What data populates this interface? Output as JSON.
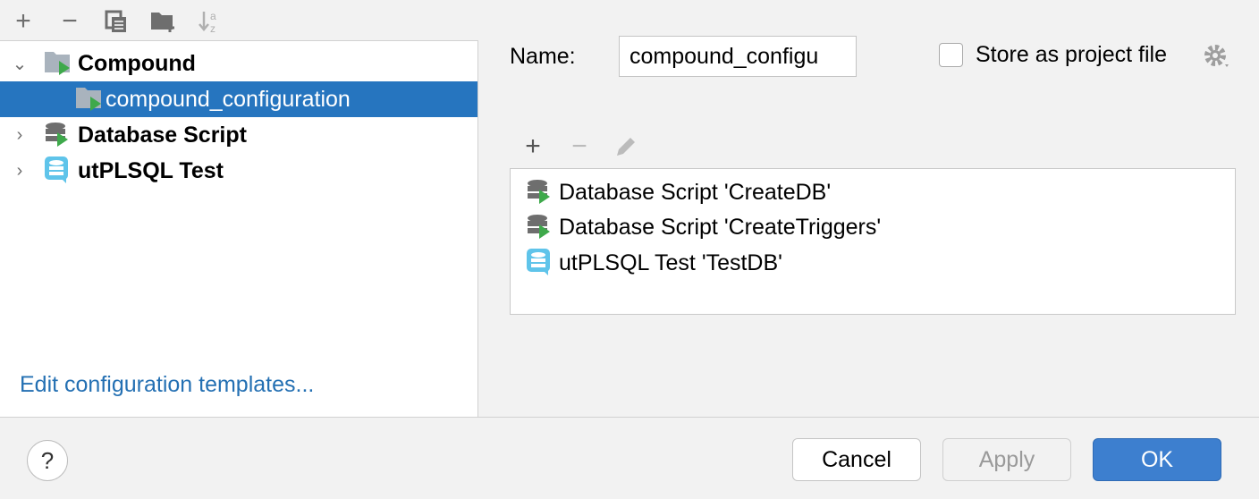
{
  "toolbar": {
    "add": "+",
    "remove": "−",
    "copy": "copy-icon",
    "new_folder": "folder-add-icon",
    "sort": "sort-az-icon"
  },
  "tree": [
    {
      "label": "Compound",
      "expanded": true,
      "icon": "compound-icon"
    },
    {
      "label": "compound_configuration",
      "selected": true,
      "icon": "compound-icon"
    },
    {
      "label": "Database Script",
      "expanded": false,
      "icon": "database-script-icon"
    },
    {
      "label": "utPLSQL Test",
      "expanded": false,
      "icon": "utplsql-icon"
    }
  ],
  "edit_templates_link": "Edit configuration templates...",
  "name_label": "Name:",
  "name_value": "compound_configu",
  "store_label": "Store as project file",
  "store_checked": false,
  "list_toolbar": {
    "add": "+",
    "remove": "−"
  },
  "list_items": [
    {
      "label": "Database Script 'CreateDB'",
      "icon": "database-script-icon"
    },
    {
      "label": "Database Script 'CreateTriggers'",
      "icon": "database-script-icon"
    },
    {
      "label": "utPLSQL Test 'TestDB'",
      "icon": "utplsql-icon"
    }
  ],
  "buttons": {
    "help": "?",
    "cancel": "Cancel",
    "apply": "Apply",
    "ok": "OK"
  },
  "colors": {
    "selection": "#2675bf",
    "ok": "#3d7fcf",
    "link": "#2470b3"
  }
}
